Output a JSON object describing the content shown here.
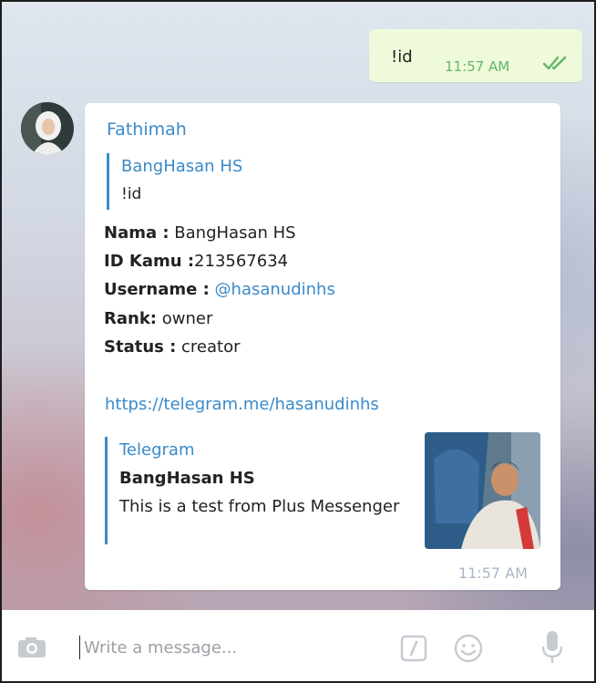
{
  "outgoing": {
    "text": "!id",
    "time": "11:57 AM",
    "status_icon": "double-check-icon"
  },
  "incoming": {
    "sender": "Fathimah",
    "reply": {
      "name": "BangHasan HS",
      "text": "!id"
    },
    "fields": [
      {
        "label": "Nama :",
        "value": " BangHasan HS"
      },
      {
        "label": "ID Kamu :",
        "value": "213567634"
      },
      {
        "label": "Username :",
        "value": " @hasanudinhs"
      },
      {
        "label": "Rank:",
        "value": " owner"
      },
      {
        "label": "Status :",
        "value": " creator"
      }
    ],
    "url": "https://telegram.me/hasanudinhs",
    "preview": {
      "site": "Telegram",
      "title": "BangHasan HS",
      "description": "This is a test from Plus Messenger"
    },
    "time": "11:57 AM"
  },
  "composer": {
    "placeholder": "Write a message..."
  },
  "colors": {
    "accent": "#3a8ac9",
    "outgoing_bubble": "#eefad9",
    "check": "#63b56d"
  }
}
